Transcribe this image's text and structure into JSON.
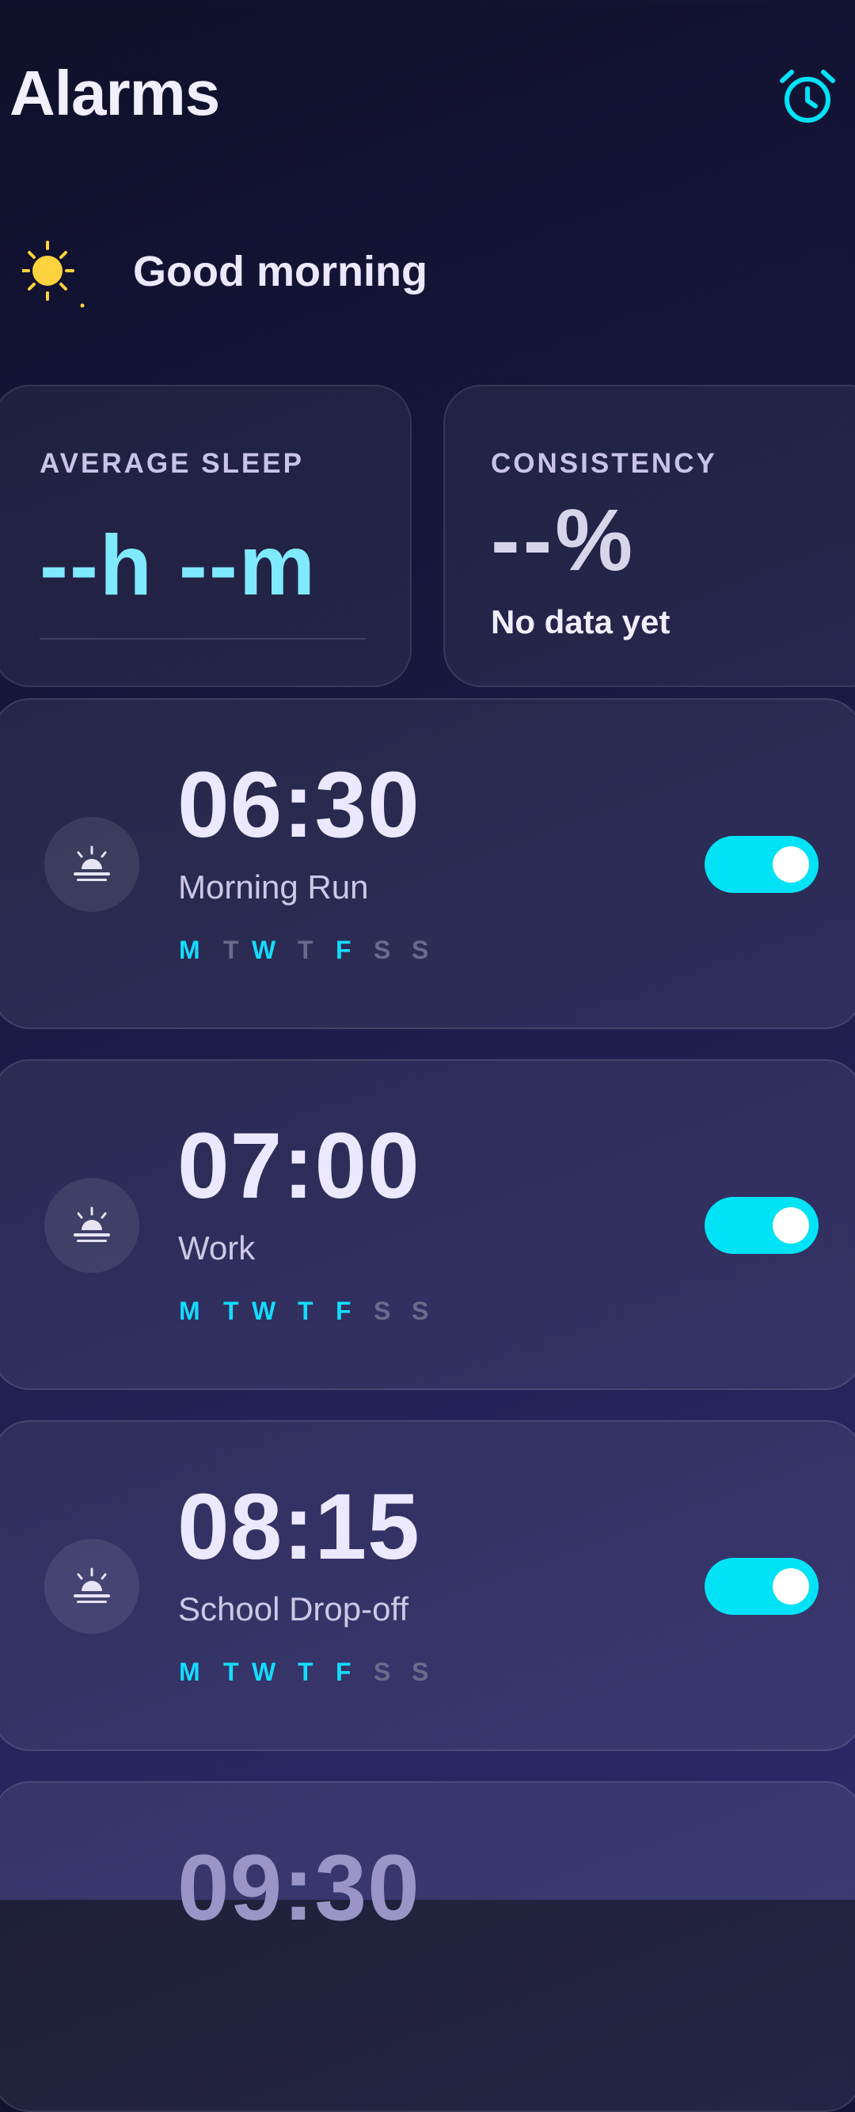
{
  "header": {
    "title": "Alarms",
    "icon": "alarm-clock-icon",
    "accent_color": "#00e2f5"
  },
  "greeting": {
    "icon": "sun-icon",
    "text": "Good morning",
    "icon_color": "#ffd23f"
  },
  "stats": {
    "average_sleep": {
      "label": "AVERAGE SLEEP",
      "value": "--h --m",
      "value_color": "#7fe9ff"
    },
    "consistency": {
      "label": "CONSISTENCY",
      "value": "--%",
      "subtitle": "No data yet"
    }
  },
  "alarms": [
    {
      "time": "06:30",
      "label": "Morning Run",
      "icon": "sunrise-icon",
      "enabled": true,
      "days": [
        {
          "letter": "M",
          "active": true
        },
        {
          "letter": "T",
          "active": false
        },
        {
          "letter": "W",
          "active": true
        },
        {
          "letter": "T",
          "active": false
        },
        {
          "letter": "F",
          "active": true
        },
        {
          "letter": "S",
          "active": false
        },
        {
          "letter": "S",
          "active": false
        }
      ]
    },
    {
      "time": "07:00",
      "label": "Work",
      "icon": "sunrise-icon",
      "enabled": true,
      "days": [
        {
          "letter": "M",
          "active": true
        },
        {
          "letter": "T",
          "active": true
        },
        {
          "letter": "W",
          "active": true
        },
        {
          "letter": "T",
          "active": true
        },
        {
          "letter": "F",
          "active": true
        },
        {
          "letter": "S",
          "active": false
        },
        {
          "letter": "S",
          "active": false
        }
      ]
    },
    {
      "time": "08:15",
      "label": "School Drop-off",
      "icon": "sunrise-icon",
      "enabled": true,
      "days": [
        {
          "letter": "M",
          "active": true
        },
        {
          "letter": "T",
          "active": true
        },
        {
          "letter": "W",
          "active": true
        },
        {
          "letter": "T",
          "active": true
        },
        {
          "letter": "F",
          "active": true
        },
        {
          "letter": "S",
          "active": false
        },
        {
          "letter": "S",
          "active": false
        }
      ]
    },
    {
      "time": "09:30"
    }
  ]
}
